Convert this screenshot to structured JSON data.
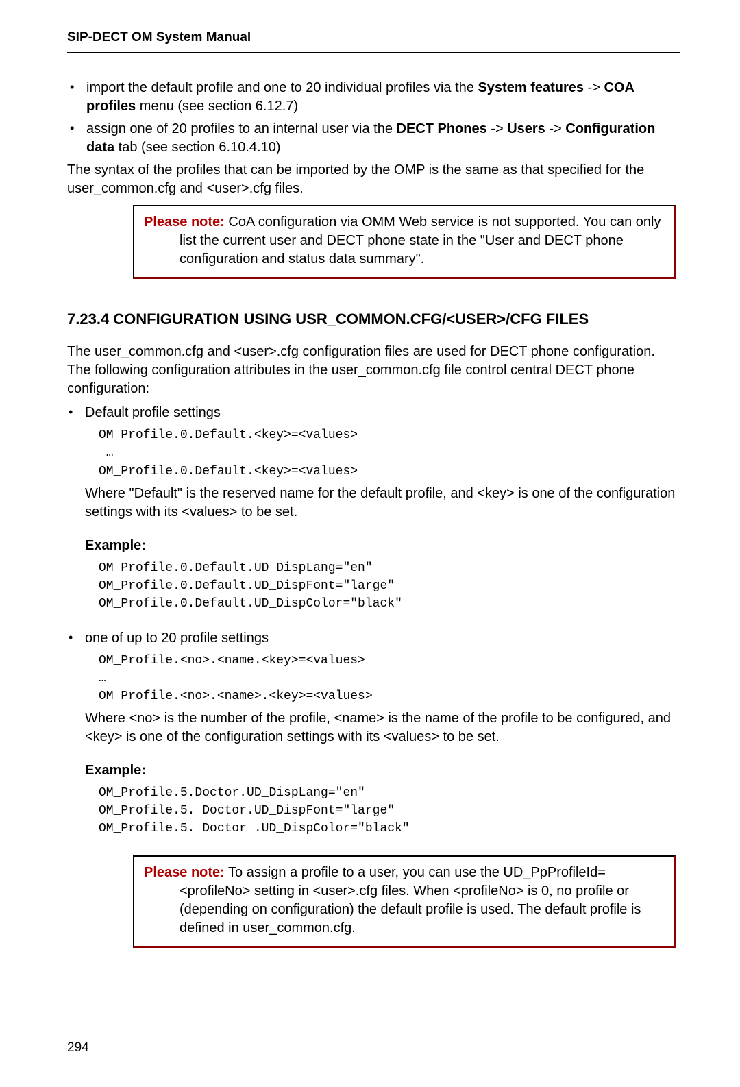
{
  "doc": {
    "header": "SIP-DECT OM System Manual",
    "page_number": "294"
  },
  "bullets_top": [
    {
      "pre": "import the default profile and one to 20 individual profiles via the ",
      "bold1": "System features",
      "mid1": " -> ",
      "bold2": "COA profiles",
      "post": " menu (see section 6.12.7)"
    },
    {
      "pre": "assign one of 20 profiles to an internal user via the ",
      "bold1": "DECT Phones",
      "mid1": " -> ",
      "bold2": "Users",
      "mid2": " -> ",
      "bold3": "Configuration data",
      "post": " tab (see section 6.10.4.10)"
    }
  ],
  "para_after_bullets": "The syntax of the profiles that can be imported by the OMP is the same as that specified for the user_common.cfg and <user>.cfg files.",
  "note1": {
    "label": "Please note:",
    "text": "  CoA configuration via OMM Web service is not supported. You can only list the current user and DECT phone state in the \"User and DECT phone configuration and status data summary\"."
  },
  "section": {
    "heading": "7.23.4 CONFIGURATION USING USR_COMMON.CFG/<USER>/CFG FILES",
    "intro": "The user_common.cfg and <user>.cfg configuration files are used for DECT phone configuration.  The following configuration attributes in the user_common.cfg file control central DECT phone configuration:",
    "item1": {
      "title": "Default profile settings",
      "code": "OM_Profile.0.Default.<key>=<values>\n …\nOM_Profile.0.Default.<key>=<values>",
      "explain": "Where \"Default\" is the reserved name for the default profile, and <key> is one of the configuration settings with its <values> to be set.",
      "example_label": "Example:",
      "example_code": "OM_Profile.0.Default.UD_DispLang=\"en\"\nOM_Profile.0.Default.UD_DispFont=\"large\"\nOM_Profile.0.Default.UD_DispColor=\"black\""
    },
    "item2": {
      "title": "one of up to 20 profile settings",
      "code": "OM_Profile.<no>.<name.<key>=<values>\n…\nOM_Profile.<no>.<name>.<key>=<values>",
      "explain": "Where <no> is the number of the profile, <name> is the name of the profile to be configured, and <key> is one of the configuration settings with its <values> to be set.",
      "example_label": "Example:",
      "example_code": "OM_Profile.5.Doctor.UD_DispLang=\"en\"\nOM_Profile.5. Doctor.UD_DispFont=\"large\"\nOM_Profile.5. Doctor .UD_DispColor=\"black\""
    }
  },
  "note2": {
    "label": "Please note:",
    "text": "  To assign a profile to a user, you can use the UD_PpProfileId= <profileNo> setting in <user>.cfg files. When <profileNo> is 0, no profile or (depending on configuration) the default profile is used. The default profile is defined in user_common.cfg."
  }
}
